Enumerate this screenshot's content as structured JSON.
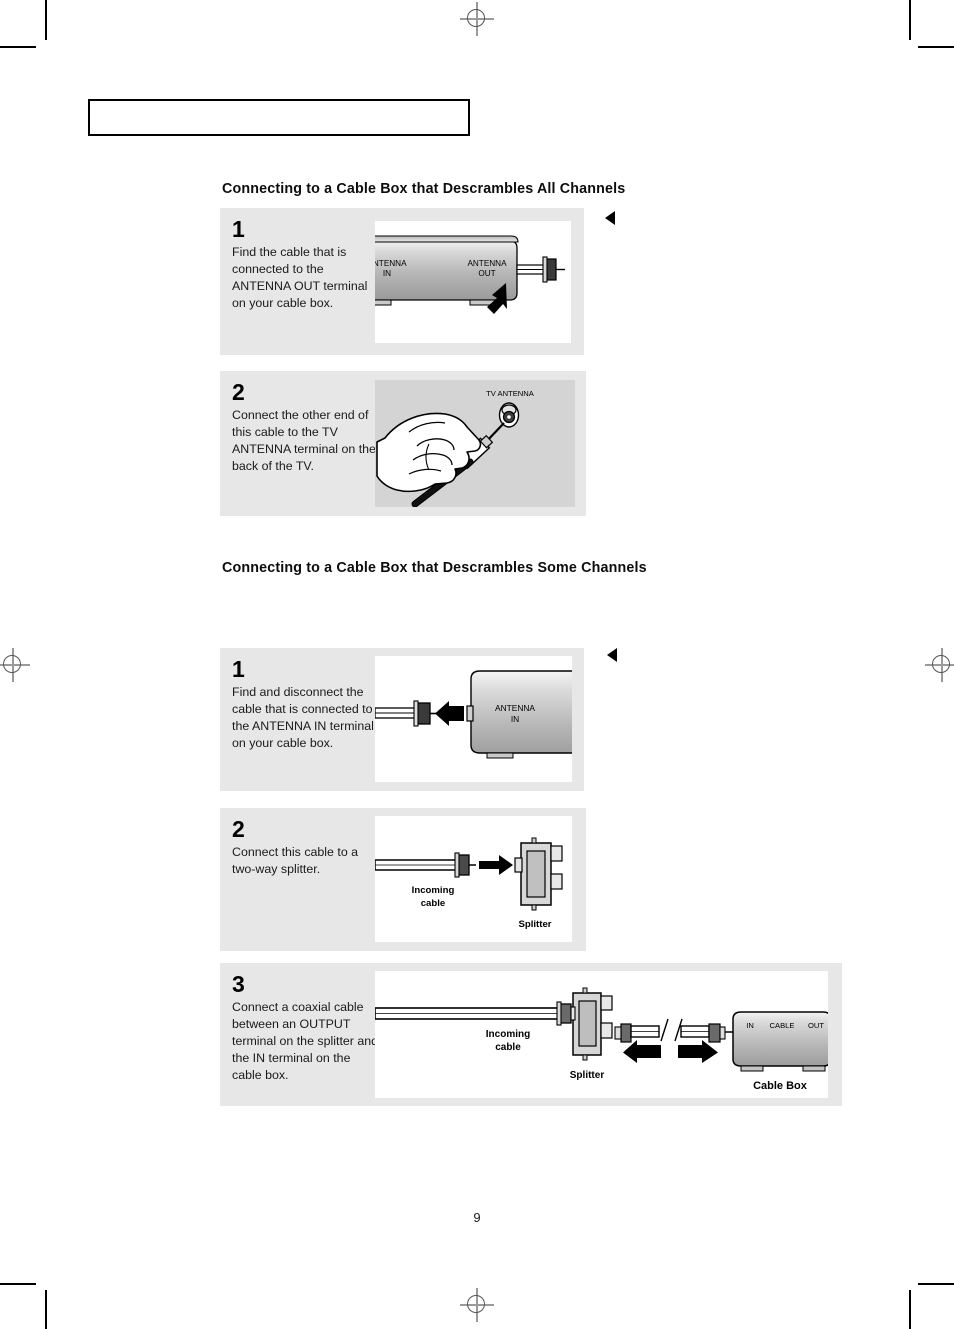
{
  "page": {
    "number": "9",
    "header_box_label": ""
  },
  "sections": [
    {
      "heading": "Connecting to a Cable Box that Descrambles All Channels",
      "steps": [
        {
          "number": "1",
          "text": "Find the cable that is connected to the ANTENNA OUT terminal on your cable box.",
          "figure": {
            "type": "cable-box-antenna-out",
            "labels": [
              "ANTENNA IN",
              "ANTENNA OUT"
            ],
            "label_in_line1": "ANTENNA",
            "label_in_line2": "IN",
            "label_out_line1": "ANTENNA",
            "label_out_line2": "OUT"
          }
        },
        {
          "number": "2",
          "text": "Connect the other end of this cable to the TV ANTENNA terminal on the back of the TV.",
          "figure": {
            "type": "hand-connecting-tv-antenna",
            "labels": [
              "TV ANTENNA"
            ],
            "label_tv_antenna": "TV ANTENNA"
          }
        }
      ]
    },
    {
      "heading": "Connecting to a Cable Box that Descrambles Some Channels",
      "steps": [
        {
          "number": "1",
          "text": "Find and disconnect the cable that is connected to the ANTENNA IN terminal on your cable box.",
          "figure": {
            "type": "disconnect-antenna-in",
            "label_in_line1": "ANTENNA",
            "label_in_line2": "IN"
          }
        },
        {
          "number": "2",
          "text": "Connect this cable to a two-way splitter.",
          "figure": {
            "type": "cable-to-splitter",
            "label_incoming_line1": "Incoming",
            "label_incoming_line2": "cable",
            "label_splitter": "Splitter"
          }
        },
        {
          "number": "3",
          "text": "Connect a coaxial cable between an OUTPUT terminal on the splitter and the IN terminal on the cable box.",
          "figure": {
            "type": "splitter-to-cable-box",
            "label_incoming_line1": "Incoming",
            "label_incoming_line2": "cable",
            "label_splitter": "Splitter",
            "label_cable_box": "Cable  Box",
            "box_port_in": "IN",
            "box_port_cable": "CABLE",
            "box_port_out": "OUT"
          }
        }
      ]
    }
  ],
  "colors": {
    "panel_bg": "#e7e7e7",
    "figure_bg": "#ffffff",
    "figure_bg_grey": "#d4d4d4",
    "text": "#1a1a1a",
    "heading": "#0d0d0d",
    "marker": "#000000"
  }
}
